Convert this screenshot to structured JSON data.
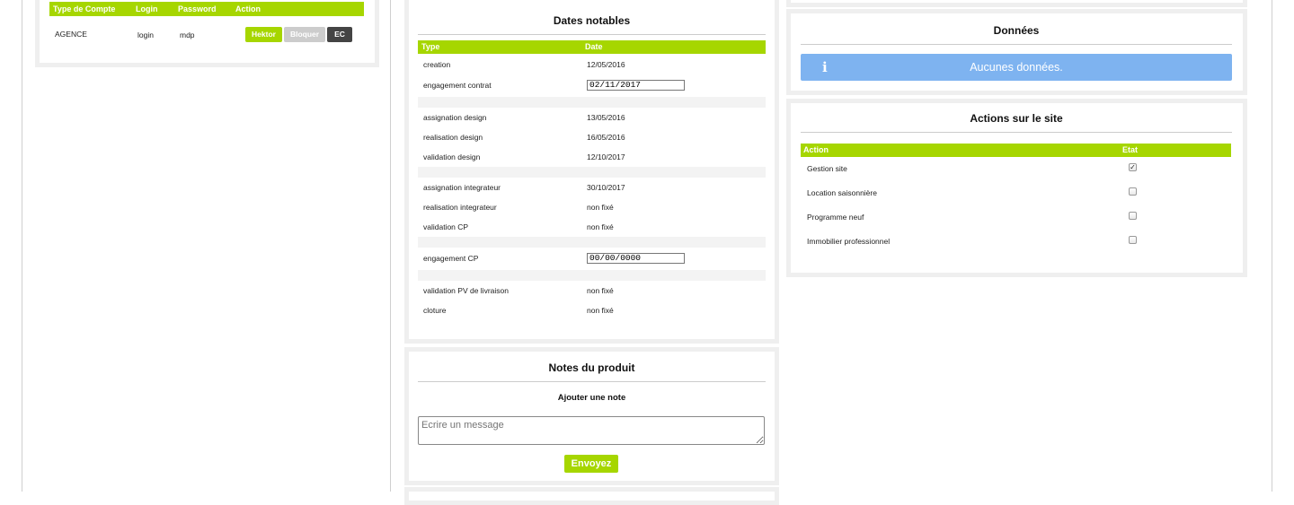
{
  "accounts": {
    "headers": [
      "Type de Compte",
      "Login",
      "Password",
      "Action"
    ],
    "row": {
      "type": "AGENCE",
      "login": "login",
      "password": "mdp"
    },
    "buttons": {
      "hektor": "Hektor",
      "bloquer": "Bloquer",
      "ec": "EC"
    }
  },
  "dates": {
    "title": "Dates notables",
    "headers": [
      "Type",
      "Date"
    ],
    "rows": [
      {
        "type": "creation",
        "date": "12/05/2016"
      },
      {
        "type": "engagement contrat",
        "date": "02/11/2017"
      },
      {
        "type": "assignation design",
        "date": "13/05/2016"
      },
      {
        "type": "realisation design",
        "date": "16/05/2016"
      },
      {
        "type": "validation design",
        "date": "12/10/2017"
      },
      {
        "type": "assignation integrateur",
        "date": "30/10/2017"
      },
      {
        "type": "realisation integrateur",
        "date": "non fixé"
      },
      {
        "type": "validation CP",
        "date": "non fixé"
      },
      {
        "type": "engagement CP",
        "date": "00/00/0000"
      },
      {
        "type": "validation PV de livraison",
        "date": "non fixé"
      },
      {
        "type": "cloture",
        "date": "non fixé"
      }
    ]
  },
  "notes": {
    "title": "Notes du produit",
    "subtitle": "Ajouter une note",
    "placeholder": "Ecrire un message",
    "send": "Envoyez"
  },
  "donnees": {
    "title": "Données",
    "info_icon": "info-icon",
    "message": "Aucunes données."
  },
  "actions": {
    "title": "Actions sur le site",
    "headers": [
      "Action",
      "Etat"
    ],
    "rows": [
      {
        "label": "Gestion site",
        "checked": true
      },
      {
        "label": "Location saisonnière",
        "checked": false
      },
      {
        "label": "Programme neuf",
        "checked": false
      },
      {
        "label": "Immobilier professionnel",
        "checked": false
      }
    ]
  },
  "colors": {
    "accent": "#a6d600",
    "info": "#7eb3f0",
    "dark": "#444444",
    "disabled": "#cccccc"
  }
}
